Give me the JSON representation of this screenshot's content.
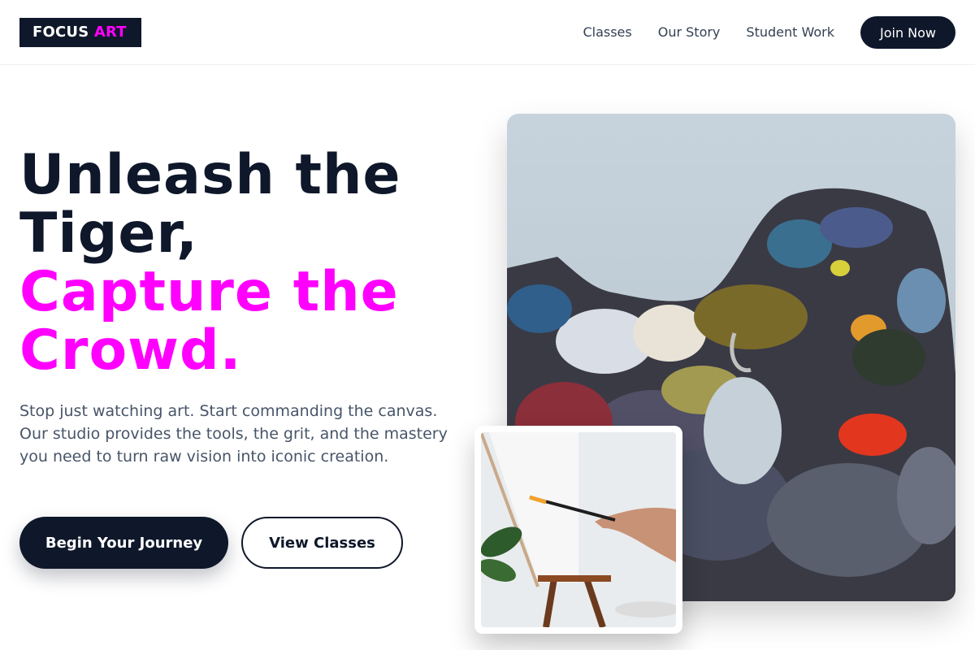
{
  "header": {
    "logo": {
      "text": "FOCUS",
      "accent": "ART"
    },
    "nav": [
      {
        "label": "Classes"
      },
      {
        "label": "Our Story"
      },
      {
        "label": "Student Work"
      }
    ],
    "cta_label": "Join Now"
  },
  "hero": {
    "title_line1": "Unleash the",
    "title_line2": "Tiger,",
    "title_line3": "Capture the",
    "title_line4": "Crowd.",
    "description": "Stop just watching art. Start commanding the canvas. Our studio provides the tools, the grit, and the mastery you need to turn raw vision into iconic creation.",
    "primary_button": "Begin Your Journey",
    "secondary_button": "View Classes"
  },
  "images": {
    "main": "paint-palette-photo",
    "inset": "painter-at-easel-photo"
  },
  "colors": {
    "dark": "#0f172a",
    "accent": "#ff00ff",
    "text_muted": "#475569"
  }
}
